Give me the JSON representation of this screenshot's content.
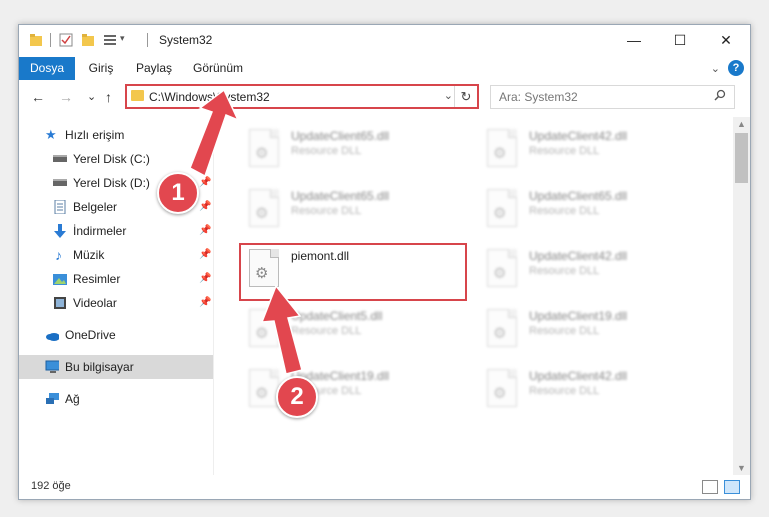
{
  "window": {
    "title": "System32",
    "minimize": "—",
    "maximize": "☐",
    "close": "✕"
  },
  "ribbon": {
    "tabs": [
      "Dosya",
      "Giriş",
      "Paylaş",
      "Görünüm"
    ],
    "help": "?"
  },
  "nav": {
    "back": "←",
    "forward": "→",
    "recent": "⌄",
    "up": "↑",
    "address": "C:\\Windows\\System32",
    "refresh": "↻",
    "search_placeholder": "Ara: System32"
  },
  "sidebar": {
    "items": [
      {
        "label": "Hızlı erişim",
        "icon": "star-icon",
        "pinned": false
      },
      {
        "label": "Yerel Disk (C:)",
        "icon": "drive-icon",
        "pinned": true
      },
      {
        "label": "Yerel Disk (D:)",
        "icon": "drive-icon",
        "pinned": true
      },
      {
        "label": "Belgeler",
        "icon": "documents-icon",
        "pinned": true
      },
      {
        "label": "İndirmeler",
        "icon": "download-icon",
        "pinned": true
      },
      {
        "label": "Müzik",
        "icon": "music-icon",
        "pinned": true
      },
      {
        "label": "Resimler",
        "icon": "pictures-icon",
        "pinned": true
      },
      {
        "label": "Videolar",
        "icon": "video-icon",
        "pinned": true
      },
      {
        "label": "OneDrive",
        "icon": "cloud-icon",
        "pinned": false
      },
      {
        "label": "Bu bilgisayar",
        "icon": "computer-icon",
        "pinned": false,
        "selected": true
      },
      {
        "label": "Ağ",
        "icon": "network-icon",
        "pinned": false
      }
    ]
  },
  "files": [
    {
      "name": "UpdateClient65.dll",
      "type": "Resource DLL",
      "blurred": true
    },
    {
      "name": "UpdateClient42.dll",
      "type": "Resource DLL",
      "blurred": true
    },
    {
      "name": "UpdateClient65.dll",
      "type": "Resource DLL",
      "blurred": true
    },
    {
      "name": "UpdateClient65.dll",
      "type": "Resource DLL",
      "blurred": true
    },
    {
      "name": "piemont.dll",
      "type": "",
      "blurred": false
    },
    {
      "name": "UpdateClient42.dll",
      "type": "Resource DLL",
      "blurred": true
    },
    {
      "name": "UpdateClient5.dll",
      "type": "Resource DLL",
      "blurred": true
    },
    {
      "name": "UpdateClient19.dll",
      "type": "Resource DLL",
      "blurred": true
    },
    {
      "name": "UpdateClient19.dll",
      "type": "Resource DLL",
      "blurred": true
    },
    {
      "name": "UpdateClient42.dll",
      "type": "Resource DLL",
      "blurred": true
    }
  ],
  "status": {
    "count": "192 öğe"
  },
  "annotations": {
    "step1": "1",
    "step2": "2",
    "color": "#e2474f"
  }
}
